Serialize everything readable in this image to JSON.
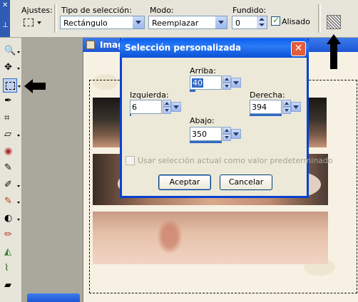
{
  "toolbar": {
    "presets_label": "Ajustes:",
    "selection_type_label": "Tipo de selección:",
    "selection_type_value": "Rectángulo",
    "mode_label": "Modo:",
    "mode_value": "Reemplazar",
    "feather_label": "Fundido:",
    "feather_value": "0",
    "antialias_label": "Alisado",
    "antialias_checked": true
  },
  "document": {
    "title": "Imag"
  },
  "dialog": {
    "title": "Selección personalizada",
    "top_label": "Arriba:",
    "top_value": "40",
    "left_label": "Izquierda:",
    "left_value": "6",
    "right_label": "Derecha:",
    "right_value": "394",
    "bottom_label": "Abajo:",
    "bottom_value": "350",
    "use_default_label": "Usar selección actual como valor predeterminado",
    "use_default_checked": false,
    "ok_label": "Aceptar",
    "cancel_label": "Cancelar",
    "close_glyph": "✕"
  },
  "tools": [
    {
      "name": "zoom-tool-icon",
      "glyph": "🔍"
    },
    {
      "name": "move-tool-icon",
      "glyph": "✥"
    },
    {
      "name": "selection-tool-icon",
      "glyph": ""
    },
    {
      "name": "dropper-tool-icon",
      "glyph": "✒"
    },
    {
      "name": "crop-tool-icon",
      "glyph": "⌗"
    },
    {
      "name": "deform-tool-icon",
      "glyph": "▱"
    },
    {
      "name": "red-eye-tool-icon",
      "glyph": "◉"
    },
    {
      "name": "clone-tool-icon",
      "glyph": "✎"
    },
    {
      "name": "scratch-remover-icon",
      "glyph": "✐"
    },
    {
      "name": "paint-brush-icon",
      "glyph": "🖌"
    },
    {
      "name": "dodge-tool-icon",
      "glyph": "◐"
    },
    {
      "name": "retouch-brush-icon",
      "glyph": "✏"
    },
    {
      "name": "eraser-background-icon",
      "glyph": "◭"
    },
    {
      "name": "smudge-tool-icon",
      "glyph": "⌇"
    },
    {
      "name": "eraser-tool-icon",
      "glyph": "▰"
    }
  ],
  "colors": {
    "title_bar": "#0a5ff0",
    "selection_accent": "#316ac5",
    "panel_bg": "#ece9d8"
  }
}
